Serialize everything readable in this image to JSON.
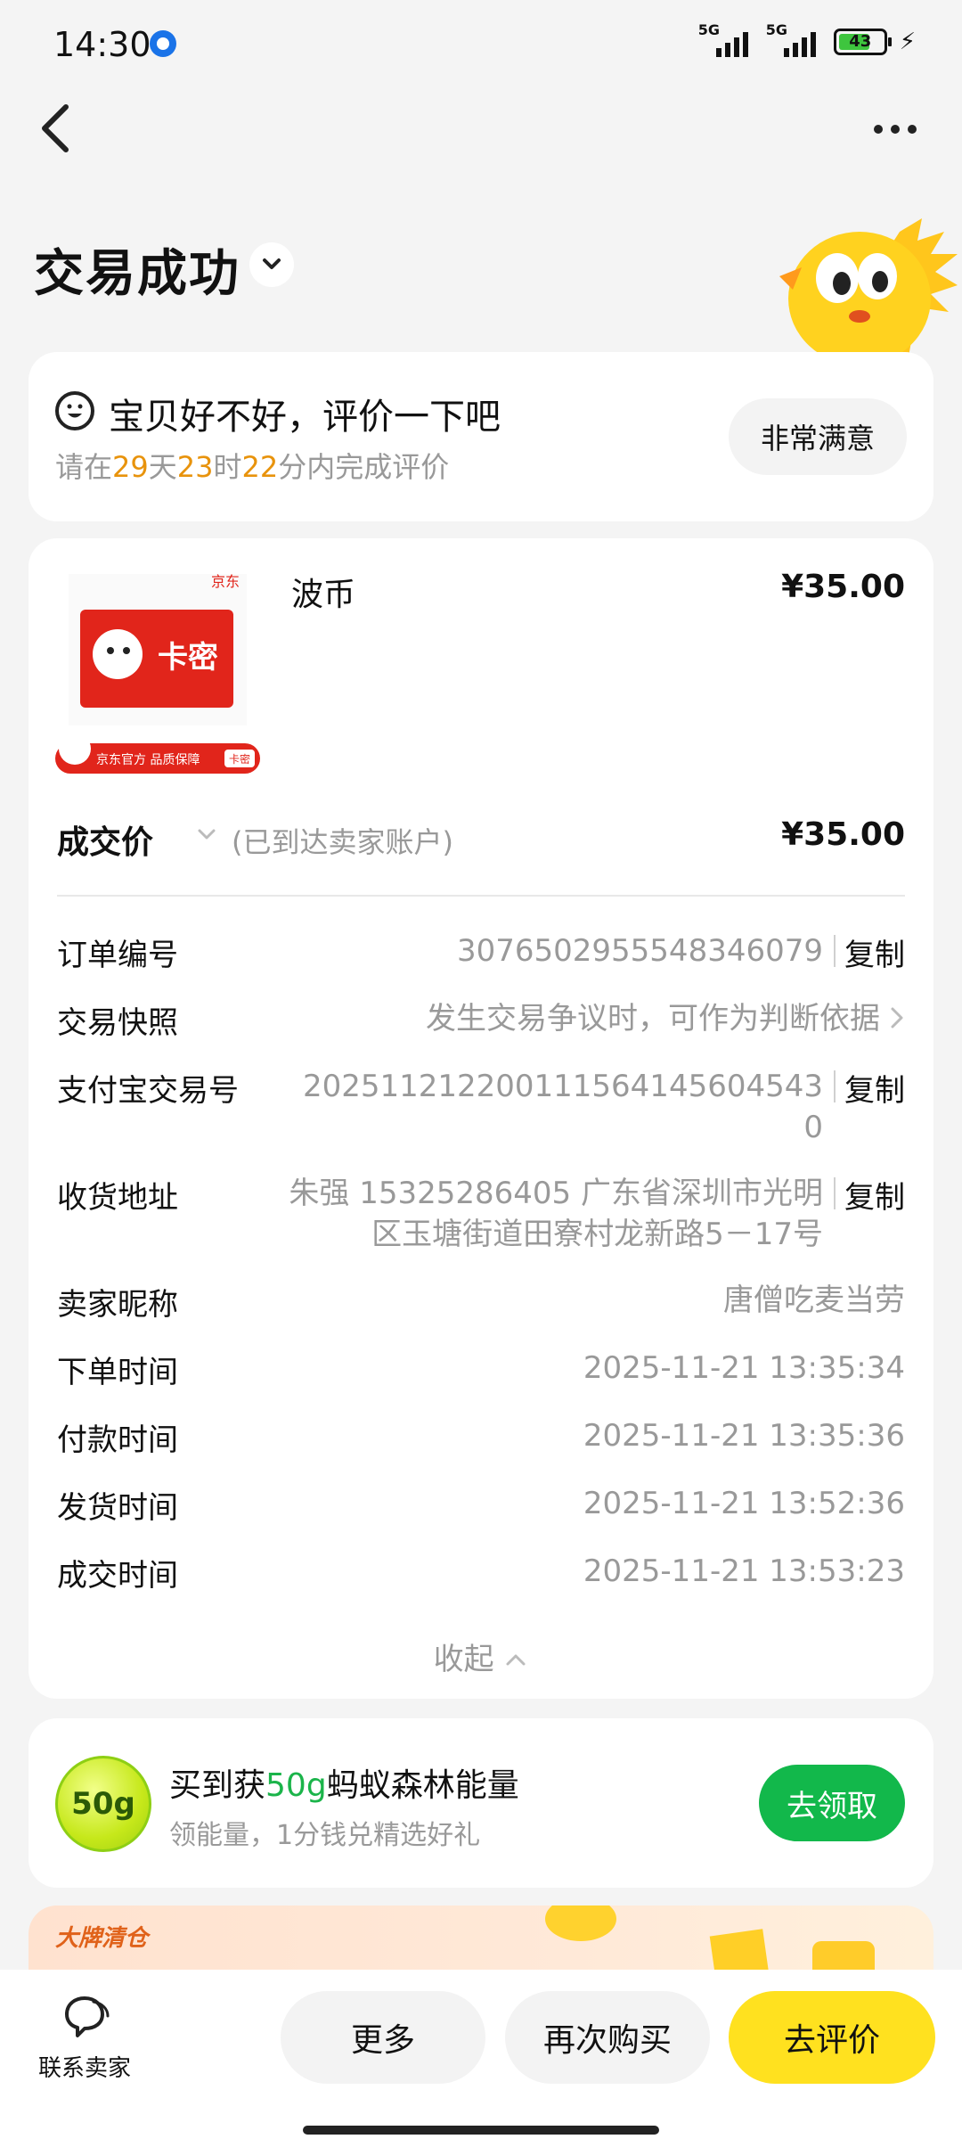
{
  "status_bar": {
    "time": "14:30",
    "sim1": "5G",
    "sim2": "5G",
    "battery": "43"
  },
  "header": {
    "title": "交易成功"
  },
  "review": {
    "title": "宝贝好不好，评价一下吧",
    "deadline_prefix": "请在",
    "days": "29",
    "days_unit": "天",
    "hours": "23",
    "hours_unit": "时",
    "minutes": "22",
    "minutes_suffix": "分内完成评价",
    "button": "非常满意"
  },
  "product": {
    "name": "波币",
    "price": "¥35.00",
    "image_brand": "京东",
    "image_card_text": "卡密",
    "image_badge_text": "京东官方 品质保障",
    "image_badge_tag": "卡密"
  },
  "deal": {
    "label": "成交价",
    "note": "(已到达卖家账户)",
    "price": "¥35.00"
  },
  "details": {
    "order_no_label": "订单编号",
    "order_no": "3076502955548346079",
    "snapshot_label": "交易快照",
    "snapshot_value": "发生交易争议时，可作为判断依据",
    "alipay_label": "支付宝交易号",
    "alipay_line1": "202511212200111564145604543",
    "alipay_line2": "0",
    "address_label": "收货地址",
    "address_line1": "朱强 15325286405 广东省深圳市光明",
    "address_line2": "区玉塘街道田寮村龙新路5－17号",
    "seller_label": "卖家昵称",
    "seller": "唐僧吃麦当劳",
    "order_time_label": "下单时间",
    "order_time": "2025-11-21 13:35:34",
    "pay_time_label": "付款时间",
    "pay_time": "2025-11-21 13:35:36",
    "ship_time_label": "发货时间",
    "ship_time": "2025-11-21 13:52:36",
    "deal_time_label": "成交时间",
    "deal_time": "2025-11-21 13:53:23",
    "copy": "复制",
    "collapse": "收起"
  },
  "energy": {
    "badge": "50g",
    "title_prefix": "买到获",
    "title_amount": "50g",
    "title_suffix": "蚂蚁森林能量",
    "sub": "领能量，1分钱兑精选好礼",
    "button": "去领取"
  },
  "promo": {
    "tag": "大牌清仓"
  },
  "bottom": {
    "contact": "联系卖家",
    "more": "更多",
    "rebuy": "再次购买",
    "review": "去评价"
  },
  "colors": {
    "accent_yellow": "#ffe11f",
    "orange_highlight": "#e8930c",
    "green_button": "#12b84b"
  }
}
